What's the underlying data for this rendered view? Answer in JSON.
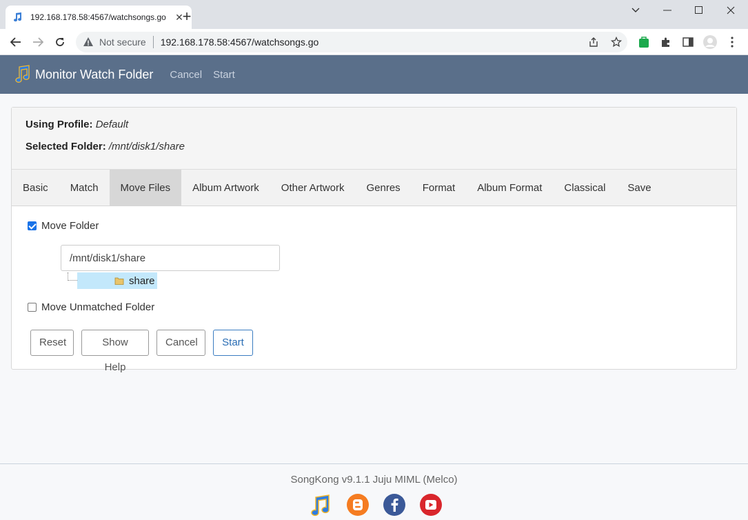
{
  "browser": {
    "tab_title": "192.168.178.58:4567/watchsongs.go",
    "security": "Not secure",
    "url": "192.168.178.58:4567/watchsongs.go"
  },
  "app": {
    "title": "Monitor Watch Folder",
    "nav_cancel": "Cancel",
    "nav_start": "Start"
  },
  "panel": {
    "profile_label": "Using Profile:",
    "profile_value": "Default",
    "folder_label": "Selected Folder:",
    "folder_value": "/mnt/disk1/share"
  },
  "tabs": [
    "Basic",
    "Match",
    "Move Files",
    "Album Artwork",
    "Other Artwork",
    "Genres",
    "Format",
    "Album Format",
    "Classical",
    "Save"
  ],
  "active_tab": "Move Files",
  "form": {
    "move_folder_label": "Move Folder",
    "move_folder_checked": true,
    "path_value": "/mnt/disk1/share",
    "tree_node": "share",
    "move_unmatched_label": "Move Unmatched Folder",
    "move_unmatched_checked": false
  },
  "buttons": {
    "reset": "Reset",
    "show_help": "Show Help",
    "cancel": "Cancel",
    "start": "Start"
  },
  "footer": {
    "version": "SongKong v9.1.1 Juju MIML (Melco)"
  },
  "colors": {
    "header_bg": "#5a6f8a",
    "primary": "#2a6db4",
    "selected_node": "#c3e8fb"
  }
}
